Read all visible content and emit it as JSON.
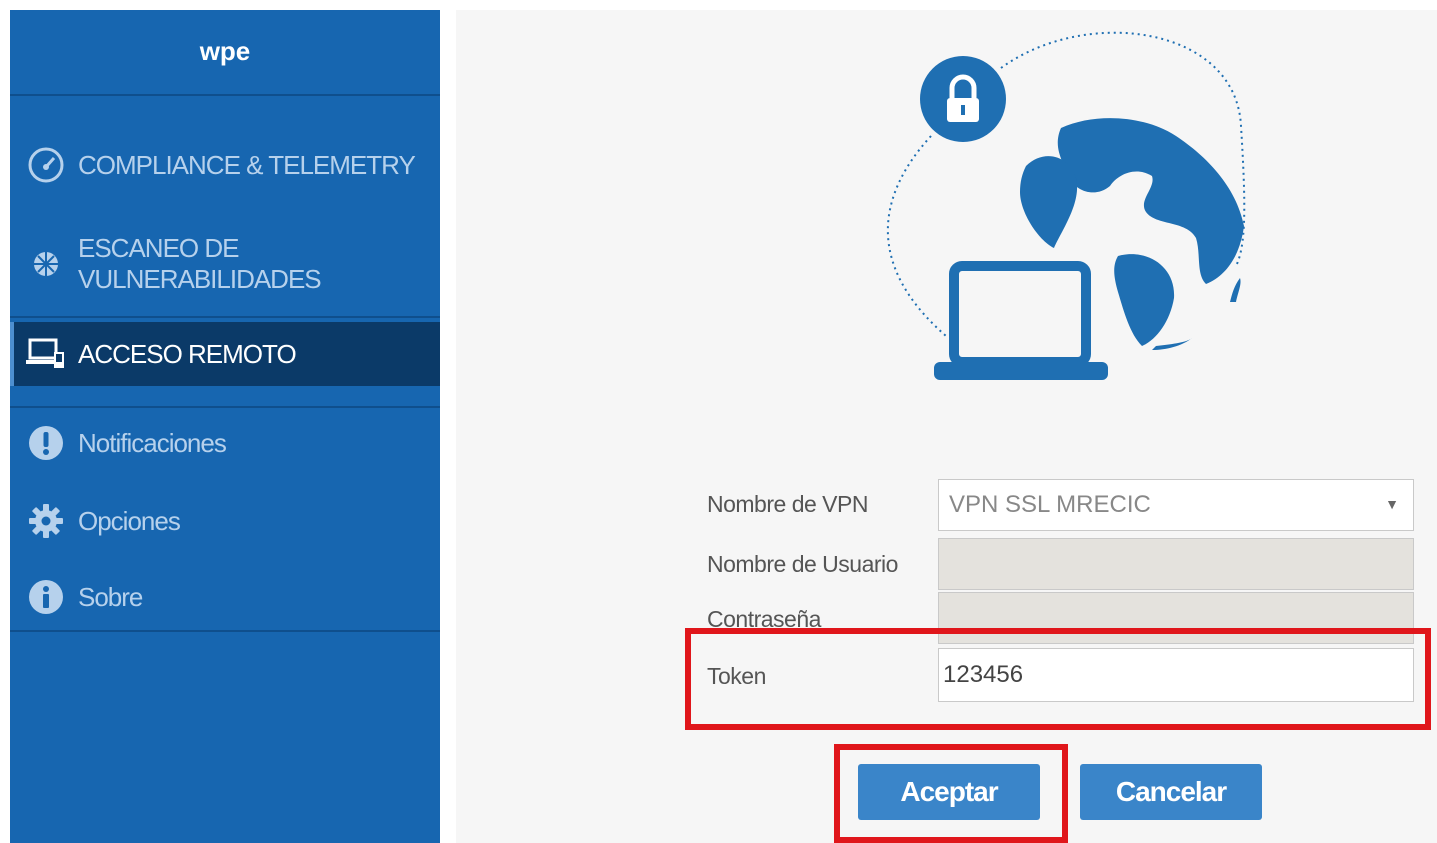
{
  "app": {
    "title": "wpe"
  },
  "sidebar": {
    "items": [
      {
        "label": "COMPLIANCE & TELEMETRY",
        "icon": "speedometer-icon",
        "active": false
      },
      {
        "label_line1": "ESCANEO DE",
        "label_line2": "VULNERABILIDADES",
        "icon": "bug-icon",
        "active": false
      },
      {
        "label": "ACCESO REMOTO",
        "icon": "remote-access-icon",
        "active": true
      },
      {
        "label": "Notificaciones",
        "icon": "alert-icon",
        "active": false
      },
      {
        "label": "Opciones",
        "icon": "gear-icon",
        "active": false
      },
      {
        "label": "Sobre",
        "icon": "info-icon",
        "active": false
      }
    ]
  },
  "illustration": {
    "name": "vpn-globe-laptop-illustration"
  },
  "form": {
    "vpn_name_label": "Nombre de VPN",
    "vpn_name_value": "VPN SSL MRECIC",
    "username_label": "Nombre de Usuario",
    "username_value": "",
    "password_label": "Contraseña",
    "password_value": "",
    "token_label": "Token",
    "token_value": "123456"
  },
  "buttons": {
    "accept": "Aceptar",
    "cancel": "Cancelar"
  },
  "colors": {
    "sidebar": "#1766b0",
    "sidebar_active": "#0b3a68",
    "accent": "#3a85c9",
    "highlight": "#e0161b",
    "illustration": "#1f6fb2"
  }
}
